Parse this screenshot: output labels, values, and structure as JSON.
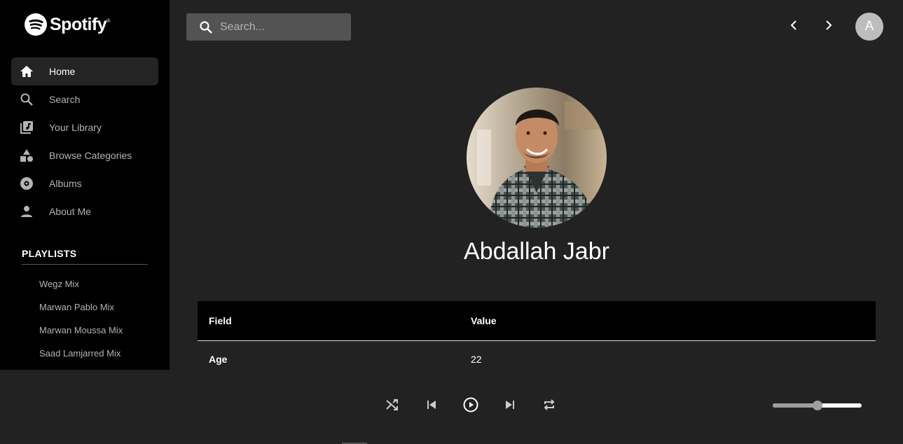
{
  "brand": {
    "name": "Spotify"
  },
  "sidebar": {
    "nav": [
      {
        "label": "Home",
        "icon": "home-icon",
        "active": true
      },
      {
        "label": "Search",
        "icon": "search-icon",
        "active": false
      },
      {
        "label": "Your Library",
        "icon": "library-icon",
        "active": false
      },
      {
        "label": "Browse Categories",
        "icon": "categories-icon",
        "active": false
      },
      {
        "label": "Albums",
        "icon": "album-icon",
        "active": false
      },
      {
        "label": "About Me",
        "icon": "person-icon",
        "active": false
      }
    ],
    "playlists_heading": "PLAYLISTS",
    "playlists": [
      "Wegz Mix",
      "Marwan Pablo Mix",
      "Marwan Moussa Mix",
      "Saad Lamjarred Mix"
    ]
  },
  "header": {
    "search_placeholder": "Search...",
    "back_icon": "chevron-left-icon",
    "forward_icon": "chevron-right-icon",
    "avatar_letter": "A"
  },
  "profile": {
    "name": "Abdallah Jabr",
    "photo_icon": "profile-photo"
  },
  "table": {
    "headers": [
      "Field",
      "Value"
    ],
    "rows": [
      {
        "field": "Age",
        "value": "22"
      }
    ]
  },
  "player": {
    "controls": [
      "shuffle-icon",
      "previous-icon",
      "play-icon",
      "next-icon",
      "repeat-icon"
    ],
    "volume": 0.5
  },
  "colors": {
    "background": "#222222",
    "sidebar": "#000000",
    "search_box": "#535353",
    "avatar": "#bdbdbd"
  }
}
